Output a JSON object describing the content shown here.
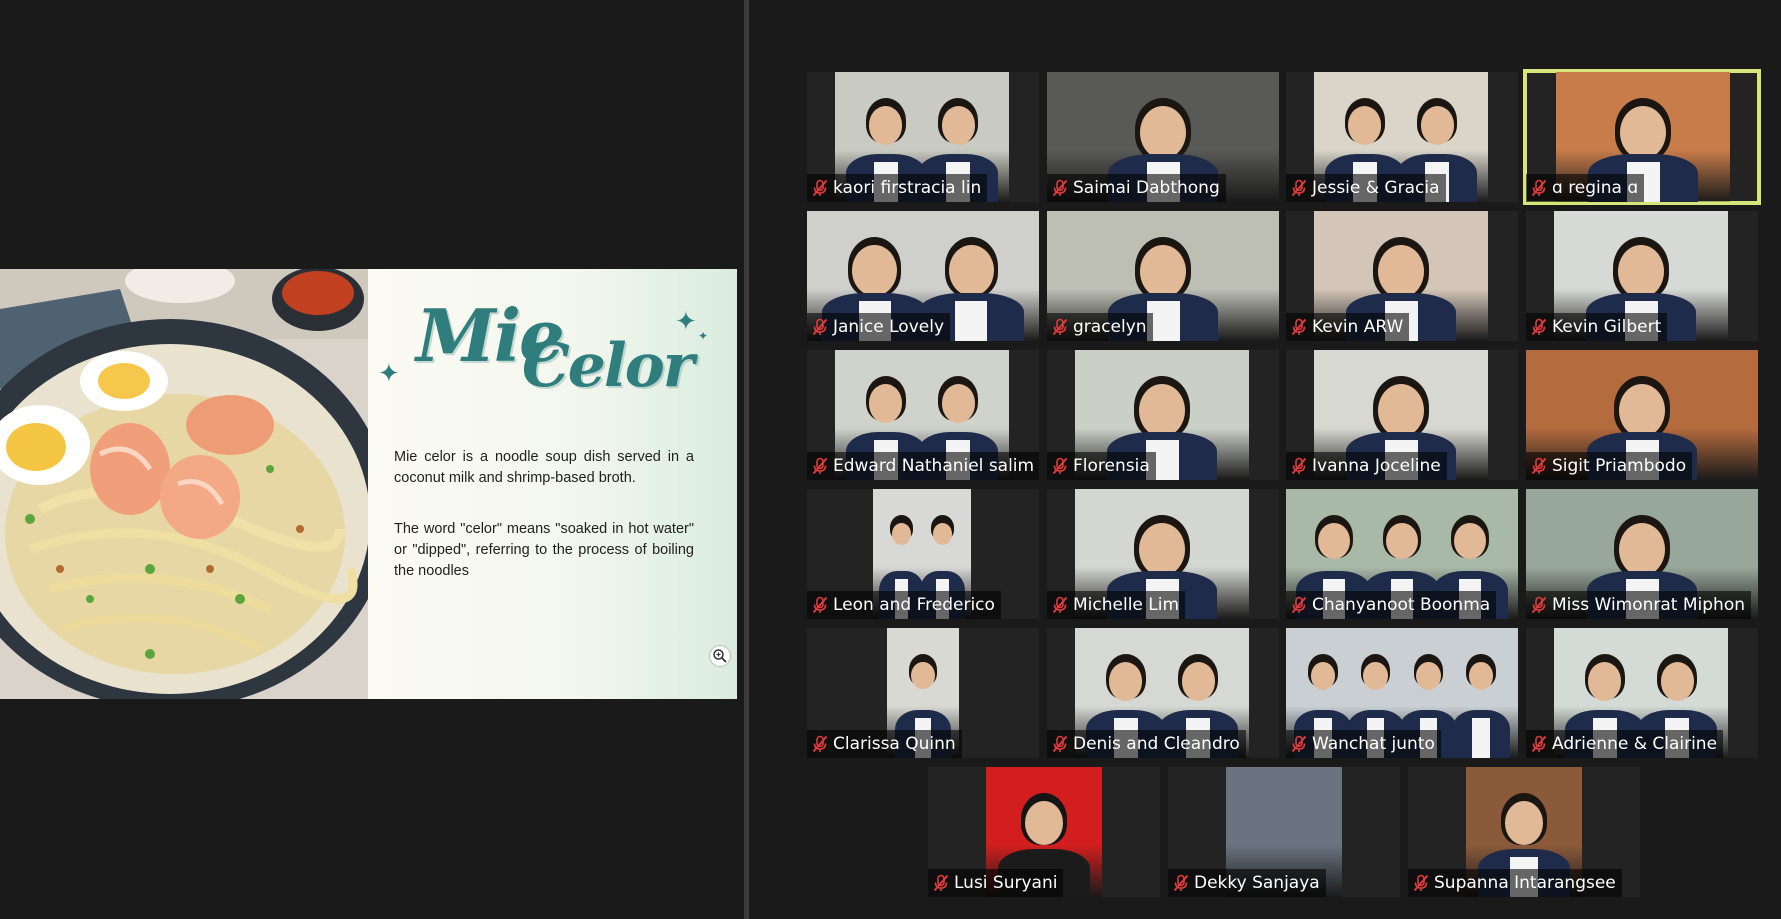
{
  "slide": {
    "title_word1": "Mie",
    "title_word2": "Celor",
    "paragraph1": "Mie celor is a noodle soup dish served in a coconut milk and shrimp-based broth.",
    "paragraph2": "The word \"celor\" means \"soaked in hot water\" or \"dipped\", referring to the process of boiling the noodles",
    "icon": "zoom-in-icon"
  },
  "gallery": {
    "active_speaker": "ɑ regina ɑ",
    "mute_icon": "microphone-muted-icon",
    "mute_color": "#e03b3b",
    "highlight_color": "#d7e57b",
    "participants": [
      {
        "name": "kaori firstracia lin",
        "muted": true
      },
      {
        "name": "Saimai Dabthong",
        "muted": true
      },
      {
        "name": "Jessie & Gracia",
        "muted": true
      },
      {
        "name": "ɑ regina ɑ",
        "muted": true
      },
      {
        "name": "Janice Lovely",
        "muted": true
      },
      {
        "name": "gracelyn",
        "muted": true
      },
      {
        "name": "Kevin ARW",
        "muted": true
      },
      {
        "name": "Kevin Gilbert",
        "muted": true
      },
      {
        "name": "Edward Nathaniel salim",
        "muted": true
      },
      {
        "name": "Florensia",
        "muted": true
      },
      {
        "name": "Ivanna Joceline",
        "muted": true
      },
      {
        "name": "Sigit Priambodo",
        "muted": true
      },
      {
        "name": "Leon and Frederico",
        "muted": true
      },
      {
        "name": "Michelle Lim",
        "muted": true
      },
      {
        "name": "Chanyanoot Boonma",
        "muted": true
      },
      {
        "name": "Miss Wimonrat Miphon",
        "muted": true
      },
      {
        "name": "Clarissa Quinn",
        "muted": true
      },
      {
        "name": "Denis and Cleandro",
        "muted": true
      },
      {
        "name": "Wanchat junto",
        "muted": true
      },
      {
        "name": "Adrienne & Clairine",
        "muted": true
      },
      {
        "name": "Lusi Suryani",
        "muted": true
      },
      {
        "name": "Dekky Sanjaya",
        "muted": true
      },
      {
        "name": "Supanna Intarangsee",
        "muted": true
      }
    ]
  }
}
